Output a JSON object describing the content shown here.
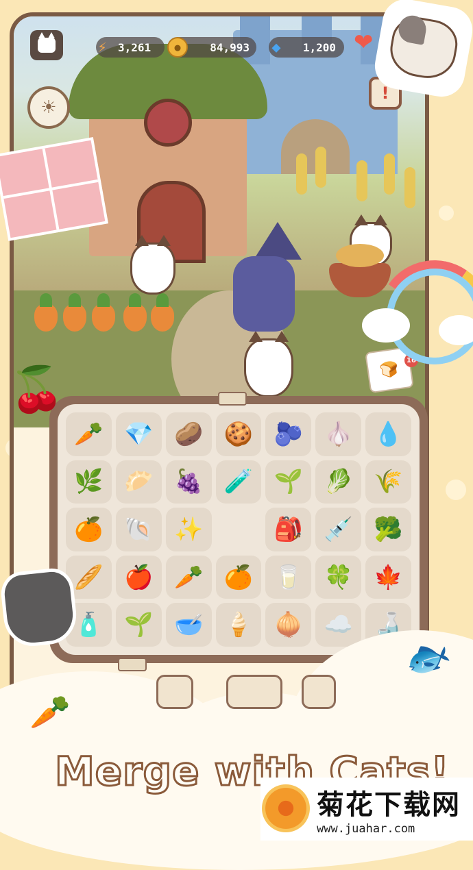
{
  "hud": {
    "energy_icon": "carrot-energy-icon",
    "energy_value": "3,261",
    "coins_icon": "coin-icon",
    "coins_value": "84,993",
    "gems_icon": "gem-icon",
    "gems_value": "1,200"
  },
  "order": {
    "badge_count": "16",
    "item_icon": "bread-icon"
  },
  "board": {
    "rows": [
      [
        {
          "icon": "carrot",
          "glyph": "🥕"
        },
        {
          "icon": "crystal-shards",
          "glyph": "💎"
        },
        {
          "icon": "potato",
          "glyph": "🥔"
        },
        {
          "icon": "cat-biscuit",
          "glyph": "🍪"
        },
        {
          "icon": "beet",
          "glyph": "🫐"
        },
        {
          "icon": "garlic",
          "glyph": "🧄"
        },
        {
          "icon": "water-pouch",
          "glyph": "💧"
        }
      ],
      [
        {
          "icon": "basil-leaves",
          "glyph": "🌿"
        },
        {
          "icon": "cat-bun",
          "glyph": "🥟"
        },
        {
          "icon": "blueberry-sprig",
          "glyph": "🍇"
        },
        {
          "icon": "magic-flask",
          "glyph": "🧪"
        },
        {
          "icon": "sprout-potato",
          "glyph": "🌱"
        },
        {
          "icon": "turnip-sprout",
          "glyph": "🥬"
        },
        {
          "icon": "wheat",
          "glyph": "🌾"
        }
      ],
      [
        {
          "icon": "orange",
          "glyph": "🍊"
        },
        {
          "icon": "seashell",
          "glyph": "🐚"
        },
        {
          "icon": "blue-star",
          "glyph": "✨"
        },
        {
          "icon": "empty",
          "glyph": ""
        },
        {
          "icon": "flour-sack",
          "glyph": "🎒"
        },
        {
          "icon": "dropper",
          "glyph": "💉"
        },
        {
          "icon": "broccoli",
          "glyph": "🥦"
        }
      ],
      [
        {
          "icon": "bread-loaf",
          "glyph": "🥖"
        },
        {
          "icon": "apple",
          "glyph": "🍎"
        },
        {
          "icon": "radish",
          "glyph": "🥕"
        },
        {
          "icon": "orange-pile",
          "glyph": "🍊"
        },
        {
          "icon": "milk-carton",
          "glyph": "🥛"
        },
        {
          "icon": "clover",
          "glyph": "🍀"
        },
        {
          "icon": "perilla-leaf",
          "glyph": "🍁"
        }
      ],
      [
        {
          "icon": "potion-bottle",
          "glyph": "🧴"
        },
        {
          "icon": "seedling",
          "glyph": "🌱"
        },
        {
          "icon": "bean-bowl",
          "glyph": "🥣"
        },
        {
          "icon": "blue-cream",
          "glyph": "🍦"
        },
        {
          "icon": "onion",
          "glyph": "🧅"
        },
        {
          "icon": "cotton",
          "glyph": "☁️"
        },
        {
          "icon": "soy-sauce",
          "glyph": "🍶"
        }
      ]
    ]
  },
  "tagline": "Merge with Cats!",
  "watermark": {
    "title": "菊花下载网",
    "url": "www.juahar.com"
  }
}
